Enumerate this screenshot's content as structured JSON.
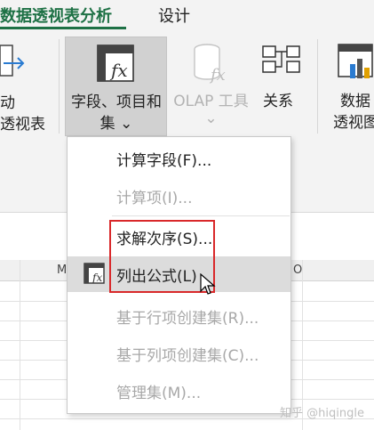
{
  "tabs": {
    "active": "数据透视表分析",
    "design": "设计"
  },
  "ribbon": {
    "left_partial_line1": "动",
    "left_partial_line2": "透视表",
    "fields_items_line1": "字段、项目和",
    "fields_items_line2": "集 ⌄",
    "olap_line1": "OLAP 工具",
    "olap_line2": "⌄",
    "relationships": "关系",
    "pivotchart_line1": "数据",
    "pivotchart_line2": "透视图"
  },
  "grid": {
    "col_m": "M",
    "col_o": "O"
  },
  "menu": {
    "items": [
      {
        "label": "计算字段(F)...",
        "disabled": false
      },
      {
        "label": "计算项(I)...",
        "disabled": true
      },
      {
        "label": "求解次序(S)...",
        "disabled": false
      },
      {
        "label": "列出公式(L)",
        "disabled": false
      },
      {
        "label": "基于行项创建集(R)...",
        "disabled": true
      },
      {
        "label": "基于列项创建集(C)...",
        "disabled": true
      },
      {
        "label": "管理集(M)...",
        "disabled": true
      }
    ]
  },
  "watermark": "知乎 @hiqingle",
  "colors": {
    "accent": "#1e7145",
    "highlight": "#d9282a"
  }
}
